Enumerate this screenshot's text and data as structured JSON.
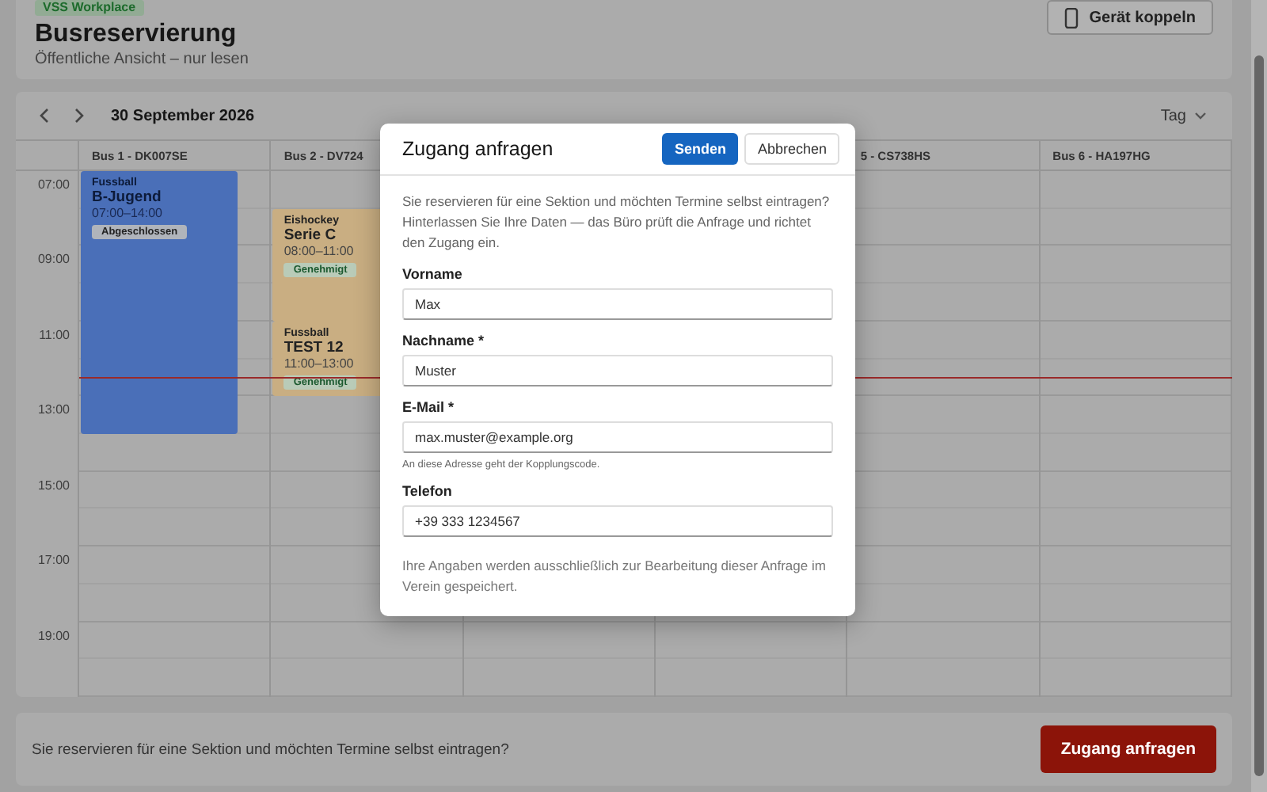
{
  "header": {
    "badge": "VSS Workplace",
    "title": "Busreservierung",
    "subtitle": "Öffentliche Ansicht – nur lesen",
    "pair_button": "Gerät koppeln"
  },
  "calendar": {
    "date": "30 September 2026",
    "view": "Tag",
    "hours": [
      "07:00",
      "09:00",
      "11:00",
      "13:00",
      "15:00",
      "17:00",
      "19:00"
    ],
    "columns": [
      {
        "label": "Bus 1 - DK007SE",
        "events": [
          {
            "category": "Fussball",
            "title": "B-Jugend",
            "time": "07:00–14:00",
            "status": "Abgeschlossen",
            "kind": "done",
            "color": "#4a6fb8"
          }
        ]
      },
      {
        "label": "Bus 2 - DV724",
        "events": [
          {
            "category": "Eishockey",
            "title": "Serie C",
            "time": "08:00–11:00",
            "status": "Genehmigt",
            "kind": "approved",
            "color": "#c9ae82"
          },
          {
            "category": "Fussball",
            "title": "TEST 12",
            "time": "11:00–13:00",
            "status": "Genehmigt",
            "kind": "approved",
            "color": "#c9ae82"
          }
        ]
      },
      {},
      {},
      {
        "label": "5 - CS738HS"
      },
      {
        "label": "Bus 6 - HA197HG"
      }
    ]
  },
  "dialog": {
    "title": "Zugang anfragen",
    "send": "Senden",
    "cancel": "Abbrechen",
    "intro": "Sie reservieren für eine Sektion und möchten Termine selbst eintragen? Hinterlassen Sie Ihre Daten — das Büro prüft die Anfrage und richtet den Zugang ein.",
    "fields": [
      {
        "label": "Vorname",
        "value": "Max"
      },
      {
        "label": "Nachname *",
        "value": "Muster"
      },
      {
        "label": "E-Mail *",
        "value": "max.muster@example.org",
        "hint": "An diese Adresse geht der Kopplungscode."
      },
      {
        "label": "Telefon",
        "value": "+39 333 1234567"
      }
    ],
    "note": "Ihre Angaben werden ausschließlich zur Bearbeitung dieser Anfrage im Verein gespeichert."
  },
  "footer": {
    "text": "Sie reservieren für eine Sektion und möchten Termine selbst eintragen?",
    "button": "Zugang anfragen"
  }
}
